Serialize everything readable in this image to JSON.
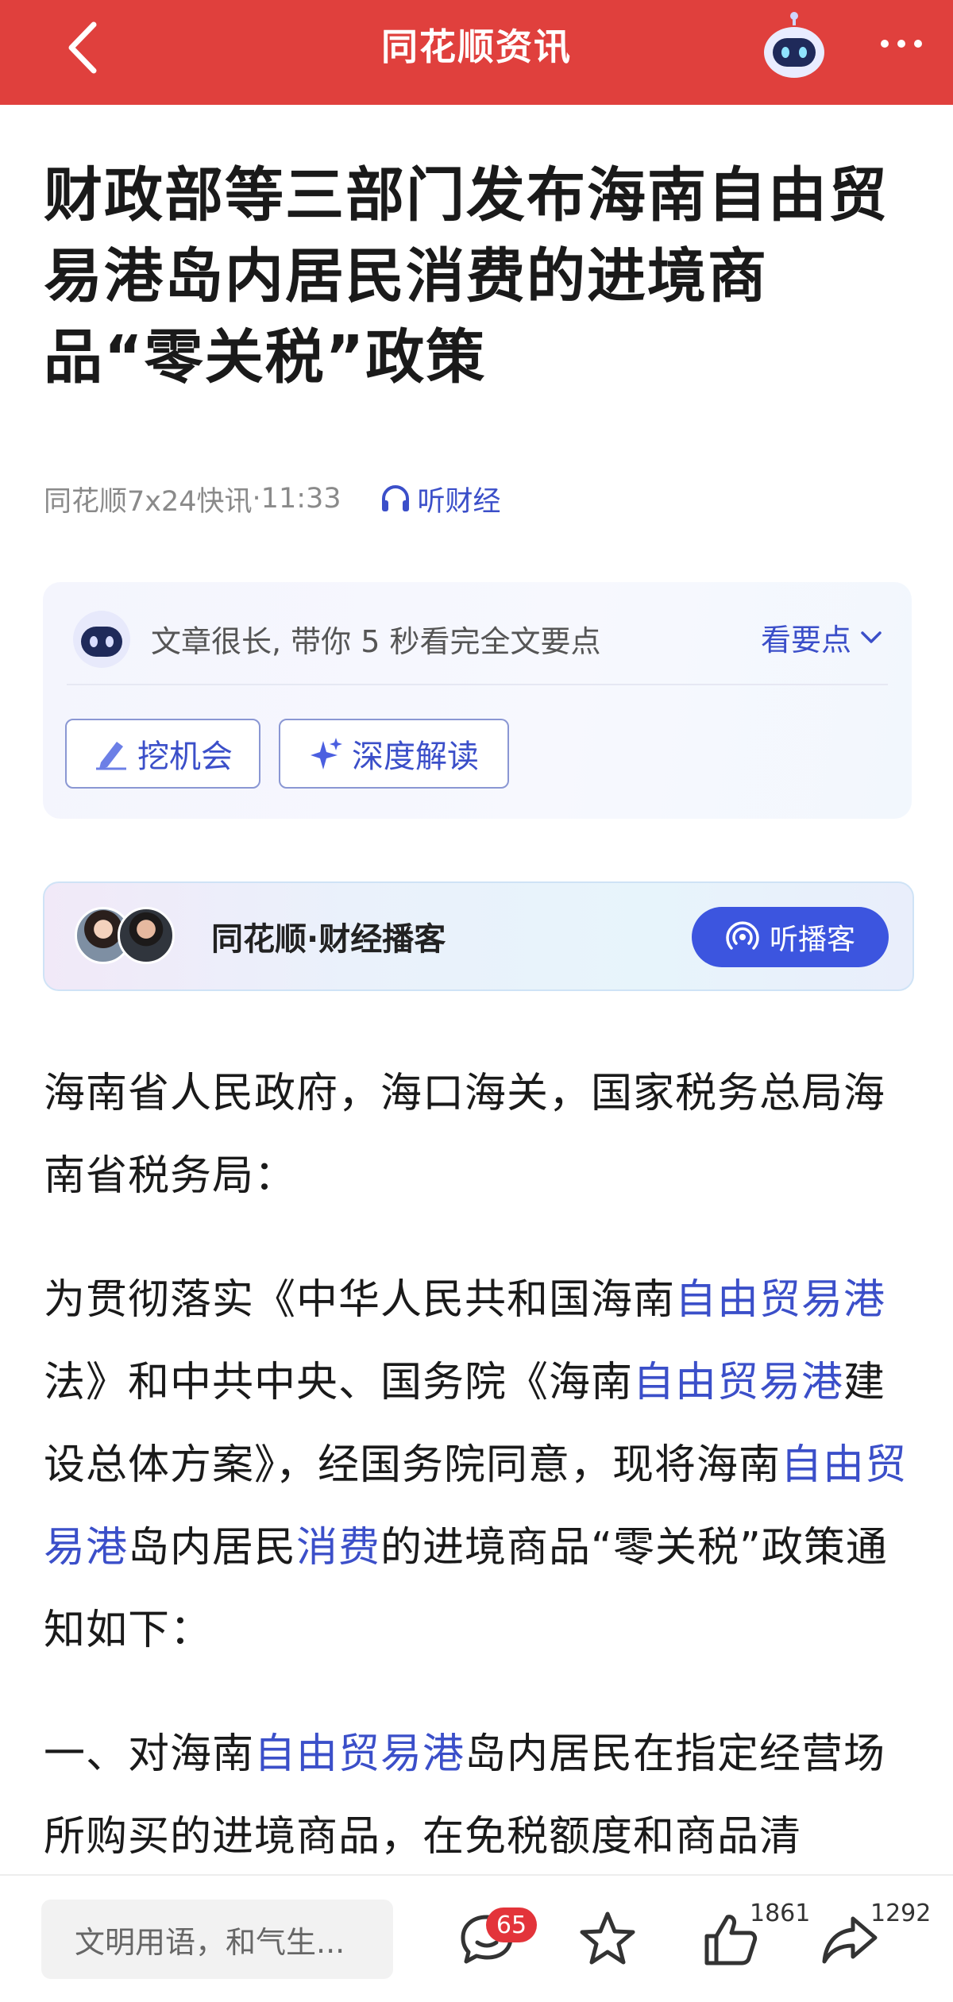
{
  "header": {
    "title": "同花顺资讯",
    "accent_color": "#e0403d"
  },
  "article": {
    "title": "财政部等三部门发布海南自由贸易港岛内居民消费的进境商品“零关税”政策",
    "source": "同花顺7x24快讯",
    "time_sep": "·",
    "time": "11:33",
    "listen_label": "听财经"
  },
  "summary": {
    "text": "文章很长, 带你 5 秒看完全文要点",
    "link_label": "看要点",
    "chips": [
      "挖机会",
      "深度解读"
    ]
  },
  "podcast": {
    "title": "同花顺·财经播客",
    "button_label": "听播客"
  },
  "body": {
    "p1": "海南省人民政府，海口海关，国家税务总局海南省税务局：",
    "p2": {
      "t1": "为贯彻落实《中华人民共和国海南",
      "l1": "自由贸易港",
      "t2": "法》和中共中央、国务院《海南",
      "l2": "自由贸易港",
      "t3": "建设总体方案》，经国务院同意，现将海南",
      "l3": "自由贸易港",
      "t4": "岛内居民",
      "l4": "消费",
      "t5": "的进境商品“零关税”政策通知如下："
    },
    "p3": {
      "t1": "一、对海南",
      "l1": "自由贸易港",
      "t2": "岛内居民在指定经营场所购买的进境商品，在免税额度和商品清"
    }
  },
  "bottom_bar": {
    "comment_placeholder": "文明用语，和气生...",
    "comment_count": "65",
    "like_count": "1861",
    "share_count": "1292"
  },
  "icons": [
    "back-arrow-icon",
    "robot-icon",
    "more-icon",
    "headphones-icon",
    "chevron-down-icon",
    "pen-icon",
    "sparkle-icon",
    "podcast-icon",
    "comment-icon",
    "star-icon",
    "thumbs-up-icon",
    "share-icon"
  ]
}
